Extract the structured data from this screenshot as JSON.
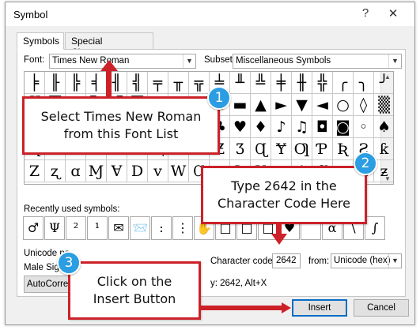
{
  "window": {
    "title": "Symbol",
    "help_label": "?",
    "close_label": "✕"
  },
  "tabs": [
    {
      "label": "Symbols",
      "active": true
    },
    {
      "label": "Special Characters",
      "active": false
    }
  ],
  "font": {
    "label": "Font:",
    "value": "Times New Roman"
  },
  "subset": {
    "label": "Subset:",
    "value": "Miscellaneous Symbols"
  },
  "symbol_grid": {
    "rows": [
      [
        "╞",
        "╟",
        "╠",
        "╡",
        "╢",
        "╣",
        "╤",
        "╥",
        "╦",
        "╧",
        "╨",
        "╩",
        "╪",
        "╫",
        "╬",
        "╭",
        "╮",
        "╯"
      ],
      [
        "▓",
        "█",
        "▄",
        "▌",
        "▐",
        "▀",
        "■",
        "□",
        "▪",
        "▫",
        "▬",
        "▲",
        "►",
        "▼",
        "◄",
        "○",
        "◊",
        "▒"
      ],
      [
        "◘",
        "◙",
        "◦",
        "☺",
        "☻",
        "☼",
        "♀",
        "♂",
        "♠",
        "♣",
        "♥",
        "♦",
        "♪",
        "♫",
        "◘",
        "◙",
        "◦",
        "♠"
      ],
      [
        "Ʀ",
        "Ƥ",
        "Ƨ",
        "Ƭ",
        "Ʊ",
        "Ħ",
        "Ⱨ",
        "Ќ",
        "ƙ",
        "Ƶ",
        "Ʒ",
        "Ɋ",
        "Ɏ",
        "Ƣ",
        "Ƥ",
        "Ʀ",
        "Ƨ",
        "ƙ"
      ],
      [
        "Ζ",
        "ʐ",
        "ɑ",
        "Ɱ",
        "Ɐ",
        "D",
        "v",
        "W",
        "Ɑ",
        "ɒ",
        "Ʋ",
        "Ɏ",
        "ɋ",
        "Ʌ",
        "Ɑ",
        "ɐ",
        "ʌ",
        "ƶ"
      ]
    ],
    "selected": "♂"
  },
  "recent": {
    "label": "Recently used symbols:",
    "symbols": [
      "♂",
      "Ψ",
      "²",
      "¹",
      "✉",
      "📨",
      ":",
      "⋮",
      "✋",
      "□",
      "□",
      "□",
      "♥",
      "",
      "α",
      "\\",
      "∫"
    ]
  },
  "unicode_name": {
    "label": "Unicode na",
    "value": "Male Sign"
  },
  "char_code": {
    "label": "Character code:",
    "value": "2642"
  },
  "from": {
    "label": "from:",
    "value": "Unicode (hex)"
  },
  "shortcut_text": "y: 2642, Alt+X",
  "buttons": {
    "autocorrect": "AutoCorrec",
    "insert": "Insert",
    "cancel": "Cancel"
  },
  "callouts": {
    "c1": {
      "number": "1",
      "line1": "Select Times New Roman",
      "line2": "from this Font List"
    },
    "c2": {
      "number": "2",
      "line1": "Type 2642 in the",
      "line2": "Character Code Here"
    },
    "c3": {
      "number": "3",
      "line1": "Click on the",
      "line2": "Insert Button"
    }
  },
  "colors": {
    "accent_blue": "#0a6cc5",
    "callout_red": "#cc2128",
    "badge_blue": "#2b9de2"
  }
}
